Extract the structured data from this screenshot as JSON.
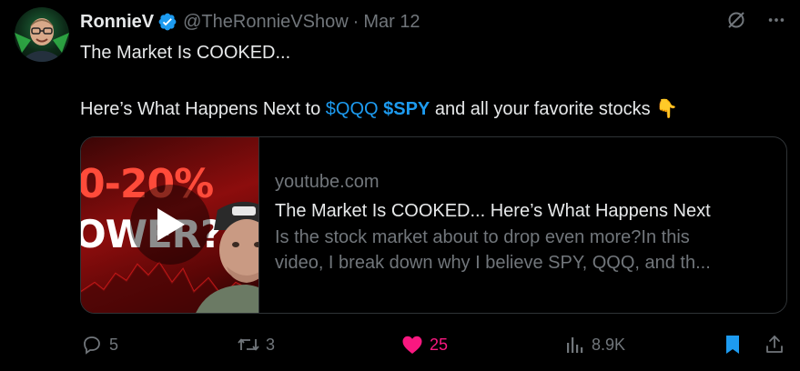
{
  "author": {
    "name": "RonnieV",
    "handle": "@TheRonnieVShow",
    "separator": "·",
    "date": "Mar 12"
  },
  "tweet": {
    "line1": "The Market Is COOKED...",
    "line2_prefix": "Here’s What Happens Next to ",
    "cashtag1": "$QQQ",
    "cashtag2": "$SPY",
    "line2_suffix": " and all your favorite stocks ",
    "emoji": "👇"
  },
  "card": {
    "domain": "youtube.com",
    "title": "The Market Is COOKED... Here’s What Happens Next",
    "description_line1": "Is the stock market about to drop even more?In this",
    "description_line2": "video, I break down why I believe SPY, QQQ, and th...",
    "thumbnail_text1": "0-20%",
    "thumbnail_text2": "OWER?"
  },
  "actions": {
    "replies": "5",
    "reposts": "3",
    "likes": "25",
    "views": "8.9K"
  },
  "colors": {
    "accent": "#1d9bf0",
    "like": "#f91880",
    "muted": "#71767b",
    "text": "#e7e9ea"
  },
  "icons": [
    "verified-badge-icon",
    "grok-icon",
    "more-icon",
    "play-icon",
    "reply-icon",
    "repost-icon",
    "heart-icon",
    "views-icon",
    "bookmark-icon",
    "share-icon"
  ]
}
